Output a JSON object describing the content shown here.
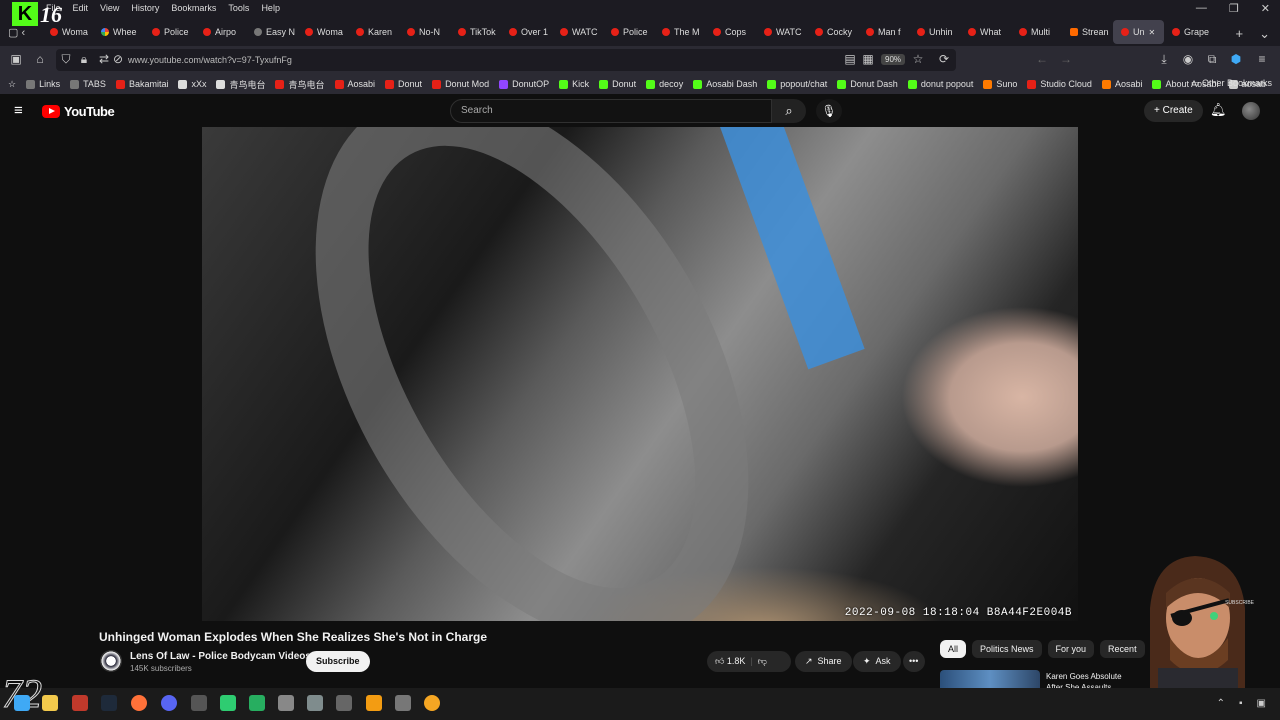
{
  "browser": {
    "menu": [
      "File",
      "Edit",
      "View",
      "History",
      "Bookmarks",
      "Tools",
      "Help"
    ],
    "overlay_badge": "16",
    "overlay_k": "K",
    "tabs": [
      {
        "label": "Woma",
        "fav": "yt"
      },
      {
        "label": "Whee",
        "fav": "g"
      },
      {
        "label": "Police",
        "fav": "yt"
      },
      {
        "label": "Airpo",
        "fav": "yt"
      },
      {
        "label": "Easy N",
        "fav": "s"
      },
      {
        "label": "Woma",
        "fav": "yt"
      },
      {
        "label": "Karen",
        "fav": "yt"
      },
      {
        "label": "No-N",
        "fav": "yt"
      },
      {
        "label": "TikTok",
        "fav": "yt"
      },
      {
        "label": "Over 1",
        "fav": "yt"
      },
      {
        "label": "WATC",
        "fav": "yt"
      },
      {
        "label": "Police",
        "fav": "yt"
      },
      {
        "label": "The M",
        "fav": "yt"
      },
      {
        "label": "Cops",
        "fav": "yt"
      },
      {
        "label": "WATC",
        "fav": "yt"
      },
      {
        "label": "Cocky",
        "fav": "yt"
      },
      {
        "label": "Man f",
        "fav": "yt"
      },
      {
        "label": "Unhin",
        "fav": "yt"
      },
      {
        "label": "What",
        "fav": "yt"
      },
      {
        "label": "Multi",
        "fav": "yt"
      },
      {
        "label": "Strean",
        "fav": "o"
      },
      {
        "label": "Un",
        "fav": "yt",
        "active": true
      },
      {
        "label": "Grape",
        "fav": "yt"
      }
    ],
    "url": "www.youtube.com/watch?v=97-TyxufnFg",
    "zoom": "90%",
    "bookmarks": [
      {
        "label": "Links",
        "color": "#777"
      },
      {
        "label": "TABS",
        "color": "#777"
      },
      {
        "label": "Bakamitai",
        "color": "#e62117"
      },
      {
        "label": "xXx",
        "color": "#ddd"
      },
      {
        "label": "青鸟电台",
        "color": "#ddd"
      },
      {
        "label": "青鸟电台",
        "color": "#e62117"
      },
      {
        "label": "Aosabi",
        "color": "#e62117"
      },
      {
        "label": "Donut",
        "color": "#e62117"
      },
      {
        "label": "Donut Mod",
        "color": "#e62117"
      },
      {
        "label": "DonutOP",
        "color": "#9146ff"
      },
      {
        "label": "Kick",
        "color": "#53fc18"
      },
      {
        "label": "Donut",
        "color": "#53fc18"
      },
      {
        "label": "decoy",
        "color": "#53fc18"
      },
      {
        "label": "Aosabi Dash",
        "color": "#53fc18"
      },
      {
        "label": "popout/chat",
        "color": "#53fc18"
      },
      {
        "label": "Donut Dash",
        "color": "#53fc18"
      },
      {
        "label": "donut popout",
        "color": "#53fc18"
      },
      {
        "label": "Suno",
        "color": "#ff7a00"
      },
      {
        "label": "Studio Cloud",
        "color": "#e62117"
      },
      {
        "label": "Aosabi",
        "color": "#ff7a00"
      },
      {
        "label": "About Aosabi",
        "color": "#53fc18"
      },
      {
        "label": "aosab",
        "color": "#ccc"
      }
    ],
    "other_bookmarks": "Other Bookmarks"
  },
  "youtube": {
    "logo_text": "YouTube",
    "search_placeholder": "Search",
    "create_label": "Create",
    "video": {
      "timestamp_overlay": "2022-09-08 18:18:04  B8A44F2E004B",
      "title": "Unhinged Woman Explodes When She Realizes She's Not in Charge",
      "channel": "Lens Of Law - Police Bodycam Videos",
      "subscribers": "145K subscribers",
      "subscribe_label": "Subscribe",
      "likes": "1.8K",
      "share_label": "Share",
      "ask_label": "Ask",
      "more_label": "•••"
    },
    "chips": [
      {
        "label": "All",
        "selected": true
      },
      {
        "label": "Politics News"
      },
      {
        "label": "For you"
      },
      {
        "label": "Recent"
      }
    ],
    "recommendation": {
      "title": "Karen Goes Absolute After She Assaults"
    }
  },
  "streamer_overlay": {
    "subscribe_text": "SUBSCRIBE"
  }
}
